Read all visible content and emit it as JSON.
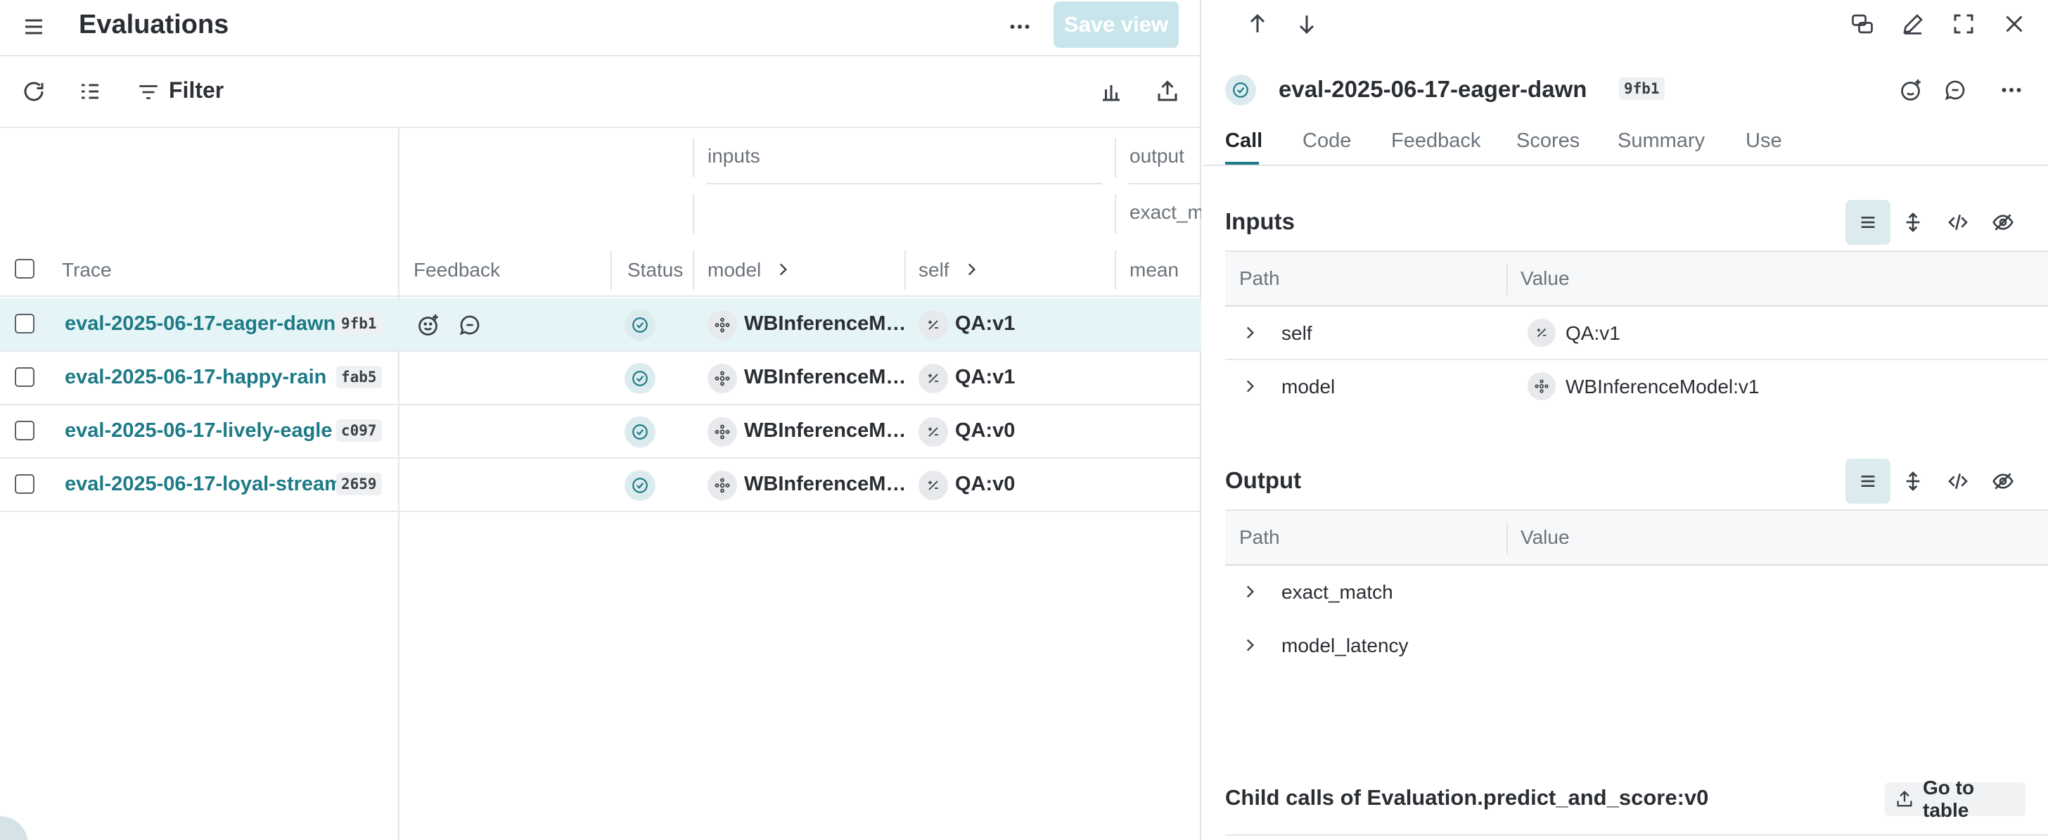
{
  "header": {
    "title": "Evaluations",
    "save_view_label": "Save view"
  },
  "toolbar": {
    "filter_label": "Filter"
  },
  "columns": {
    "group_inputs": "inputs",
    "group_output": "output",
    "sub_output": "exact_m",
    "trace": "Trace",
    "feedback": "Feedback",
    "status": "Status",
    "model": "model",
    "self": "self",
    "mean": "mean"
  },
  "rows": [
    {
      "name": "eval-2025-06-17-eager-dawn",
      "hash": "9fb1",
      "model": "WBInferenceM…",
      "self": "QA:v1",
      "selected": true
    },
    {
      "name": "eval-2025-06-17-happy-rain",
      "hash": "fab5",
      "model": "WBInferenceM…",
      "self": "QA:v1",
      "selected": false
    },
    {
      "name": "eval-2025-06-17-lively-eagle",
      "hash": "c097",
      "model": "WBInferenceM…",
      "self": "QA:v0",
      "selected": false
    },
    {
      "name": "eval-2025-06-17-loyal-stream",
      "hash": "2659",
      "model": "WBInferenceM…",
      "self": "QA:v0",
      "selected": false
    }
  ],
  "detail": {
    "call_name": "eval-2025-06-17-eager-dawn",
    "call_hash": "9fb1",
    "tabs": [
      "Call",
      "Code",
      "Feedback",
      "Scores",
      "Summary",
      "Use"
    ],
    "active_tab": "Call",
    "inputs": {
      "title": "Inputs",
      "path_header": "Path",
      "value_header": "Value",
      "rows": [
        {
          "path": "self",
          "value": "QA:v1"
        },
        {
          "path": "model",
          "value": "WBInferenceModel:v1"
        }
      ]
    },
    "output": {
      "title": "Output",
      "path_header": "Path",
      "value_header": "Value",
      "rows": [
        {
          "path": "exact_match"
        },
        {
          "path": "model_latency"
        }
      ]
    },
    "child_calls_title": "Child calls of Evaluation.predict_and_score:v0",
    "go_to_table_label": "Go to table"
  },
  "colors": {
    "accent": "#1d7a86",
    "selected_row": "#e5f4f6",
    "active_chip": "#dcecee",
    "save_button": "#c7e5ea"
  }
}
